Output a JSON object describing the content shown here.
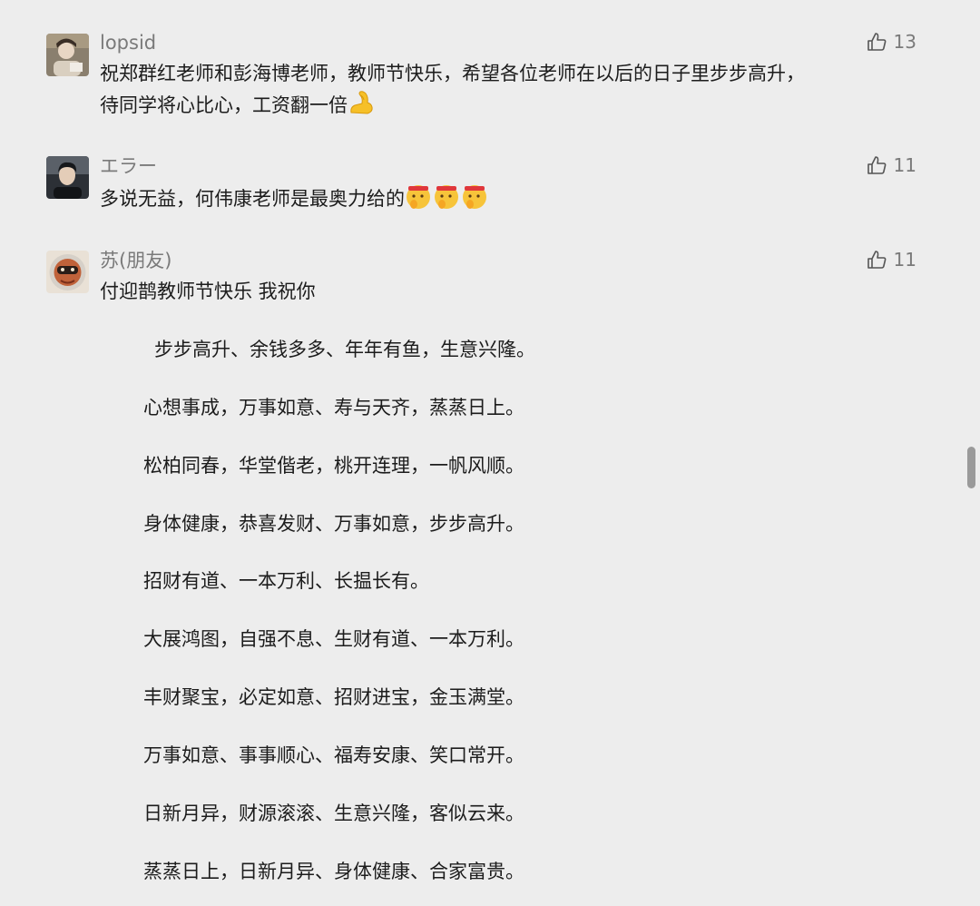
{
  "comments": [
    {
      "username": "lopsid",
      "likes": "13",
      "lines": [
        "祝郑群红老师和彭海博老师，教师节快乐，希望各位老师在以后的日子里步步高升，",
        "待同学将心比心，工资翻一倍"
      ],
      "emoji_icon": "flexed-biceps-icon"
    },
    {
      "username": "エラー",
      "likes": "11",
      "lines": [
        "多说无益，何伟康老师是最奥力给的"
      ],
      "emoji_icon": "shushing-face-icon"
    },
    {
      "username": "苏(朋友)",
      "likes": "11",
      "lines": [
        "付迎鹊教师节快乐 我祝你"
      ],
      "poem": [
        "步步高升、余钱多多、年年有鱼，生意兴隆。",
        "心想事成，万事如意、寿与天齐，蒸蒸日上。",
        "松柏同春，华堂偕老，桃开连理，一帆风顺。",
        "身体健康，恭喜发财、万事如意，步步高升。",
        "招财有道、一本万利、长揾长有。",
        "大展鸿图，自强不息、生财有道、一本万利。",
        "丰财聚宝，必定如意、招财进宝，金玉满堂。",
        "万事如意、事事顺心、福寿安康、笑口常开。",
        "日新月异，财源滚滚、生意兴隆，客似云来。",
        "蒸蒸日上，日新月异、身体健康、合家富贵。"
      ]
    }
  ],
  "colors": {
    "background": "#ededed",
    "username": "#7a7a7a",
    "text": "#1c1c1c"
  }
}
